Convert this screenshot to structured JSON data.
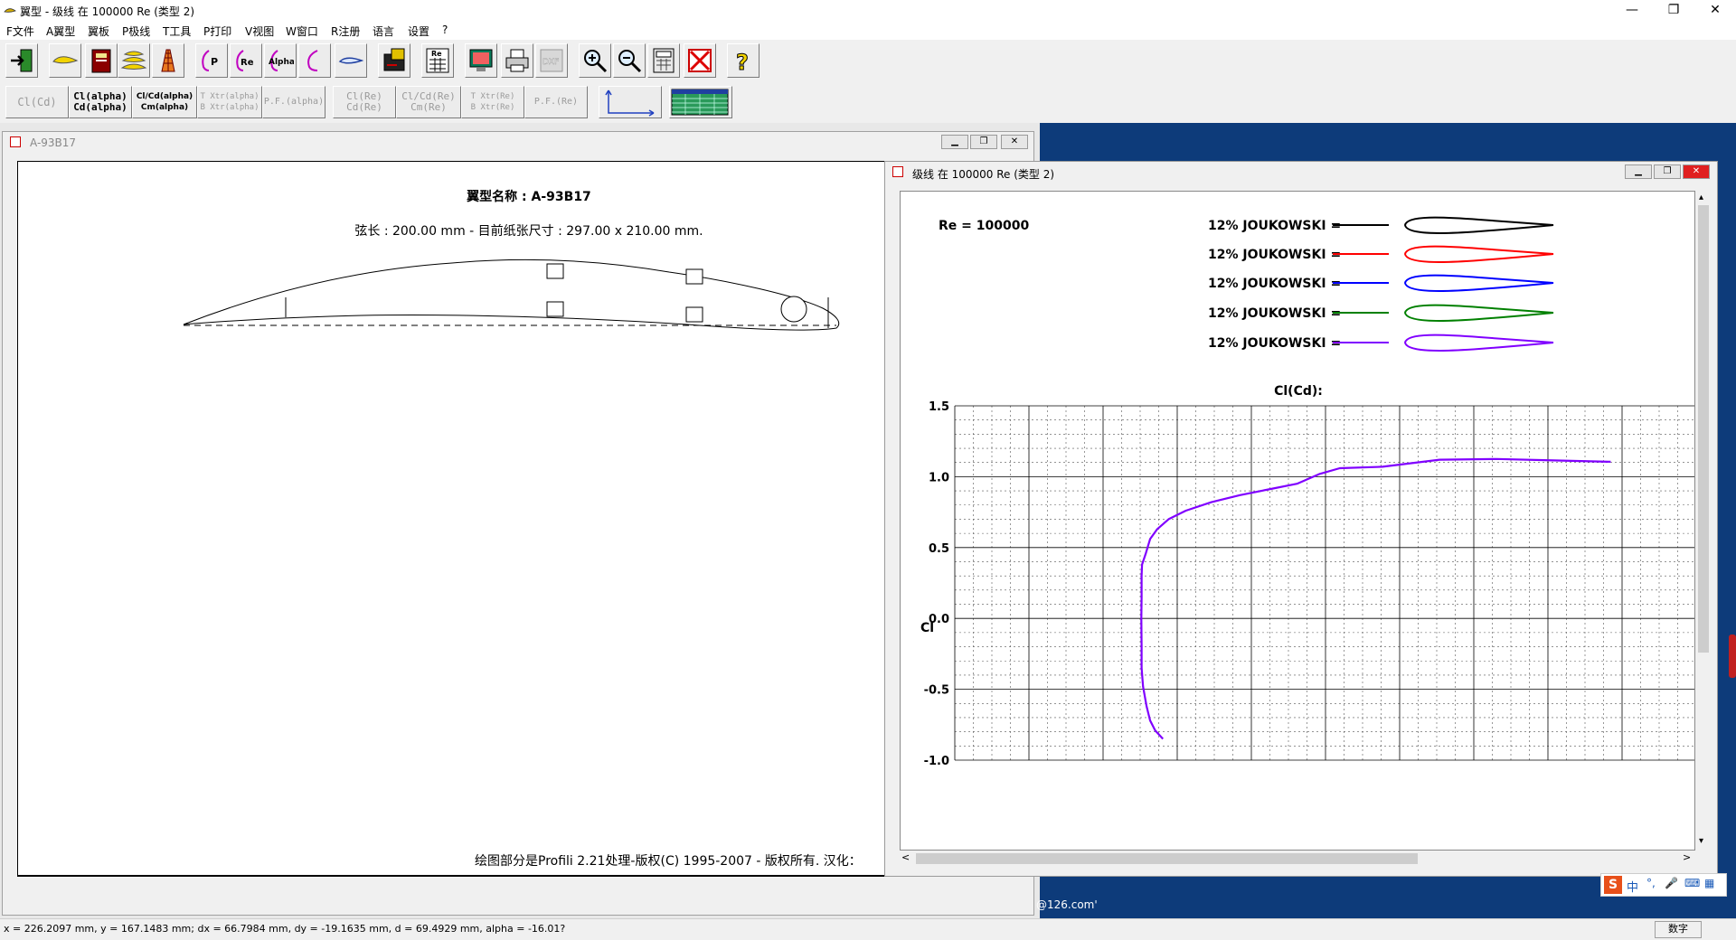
{
  "window": {
    "title": "翼型 - 级线 在 100000 Re (类型 2)",
    "minimize": "—",
    "maximize": "❐",
    "close": "✕"
  },
  "menu": [
    "F文件",
    "A翼型",
    "翼板",
    "P极线",
    "T工具",
    "P打印",
    "V视图",
    "W窗口",
    "R注册",
    "语言",
    "设置",
    "?"
  ],
  "toolbar": {
    "icons": [
      "exit-icon",
      "airfoil-icon",
      "database-icon",
      "stack-airfoils-icon",
      "wing-grid-icon",
      "polar-p-icon",
      "polar-re-icon",
      "polar-alpha-icon",
      "polar-curve-icon",
      "airfoil-shape-icon",
      "export-icon",
      "re-table-icon",
      "monitor-icon",
      "printer-icon",
      "dxf-icon",
      "zoom-in-icon",
      "zoom-out-icon",
      "calculator-icon",
      "close-red-icon",
      "help-icon"
    ],
    "dxf_label": "DXF",
    "re_label": "Re",
    "p_label": "P",
    "alpha_label": "Alpha"
  },
  "toolbar2": [
    {
      "line1": "Cl(Cd)",
      "line2": "",
      "state": "disabled"
    },
    {
      "line1": "Cl(alpha)",
      "line2": "Cd(alpha)",
      "state": "bold"
    },
    {
      "line1": "Cl/Cd(alpha)",
      "line2": "Cm(alpha)",
      "state": "bold"
    },
    {
      "line1": "T Xtr(alpha)",
      "line2": "B Xtr(alpha)",
      "state": "disabled"
    },
    {
      "line1": "P.F.(alpha)",
      "line2": "",
      "state": "disabled"
    },
    {
      "line1": "Cl(Re)",
      "line2": "Cd(Re)",
      "state": "disabled"
    },
    {
      "line1": "Cl/Cd(Re)",
      "line2": "Cm(Re)",
      "state": "disabled"
    },
    {
      "line1": "T Xtr(Re)",
      "line2": "B Xtr(Re)",
      "state": "disabled"
    },
    {
      "line1": "P.F.(Re)",
      "line2": "",
      "state": "disabled"
    }
  ],
  "airfoil_window": {
    "title": "A-93B17",
    "profile_name": "翼型名称 : A-93B17",
    "chord_text": "弦长 : 200.00 mm - 目前纸张尺寸 : 297.00 x 210.00 mm.",
    "footer": "绘图部分是Profili 2.21处理-版权(C) 1995-2007 - 版权所有. 汉化：",
    "ribs": [
      "spar-upper-1",
      "spar-upper-2",
      "spar-lower-1",
      "spar-lower-2"
    ]
  },
  "polar_window": {
    "title": "级线 在 100000 Re (类型 2)",
    "re_label": "Re = 100000",
    "legend": [
      {
        "label": "12% JOUKOWSKI =",
        "color": "#000000"
      },
      {
        "label": "12% JOUKOWSKI =",
        "color": "#ff0000"
      },
      {
        "label": "12% JOUKOWSKI =",
        "color": "#0000ff"
      },
      {
        "label": "12% JOUKOWSKI =",
        "color": "#008000"
      },
      {
        "label": "12% JOUKOWSKI =",
        "color": "#8000ff"
      }
    ]
  },
  "chart_data": {
    "type": "line",
    "title": "Cl(Cd):",
    "xlabel": "",
    "ylabel": "Cl",
    "ylim": [
      -1.0,
      1.5
    ],
    "yticks": [
      1.5,
      1.0,
      0.5,
      0.0,
      -0.5,
      -1.0
    ],
    "ytick_labels": [
      "1.5",
      "1.0",
      "0.5",
      "0.0",
      "-0.5",
      "-1.0"
    ],
    "grid": true,
    "series": [
      {
        "color": "#8000ff",
        "x": [
          0.146,
          0.1405,
          0.137,
          0.1345,
          0.132,
          0.131,
          0.131,
          0.1308,
          0.131,
          0.131,
          0.1313,
          0.134,
          0.137,
          0.142,
          0.15,
          0.162,
          0.18,
          0.2,
          0.22,
          0.24,
          0.256,
          0.27,
          0.3,
          0.34,
          0.38,
          0.42,
          0.46
        ],
        "y": [
          -0.85,
          -0.79,
          -0.72,
          -0.62,
          -0.48,
          -0.35,
          -0.2,
          0.0,
          0.15,
          0.3,
          0.38,
          0.46,
          0.56,
          0.63,
          0.7,
          0.76,
          0.82,
          0.87,
          0.91,
          0.95,
          1.02,
          1.06,
          1.07,
          1.12,
          1.125,
          1.115,
          1.105
        ]
      }
    ]
  },
  "status": {
    "coords": "x = 226.2097 mm, y = 167.1483 mm; dx = 66.7984 mm, dy = -19.1635 mm, d = 69.4929 mm, alpha = -16.01?",
    "numlock": "数字"
  },
  "desktop": {
    "email_fragment": "@126.com'",
    "ime_label": "中"
  }
}
